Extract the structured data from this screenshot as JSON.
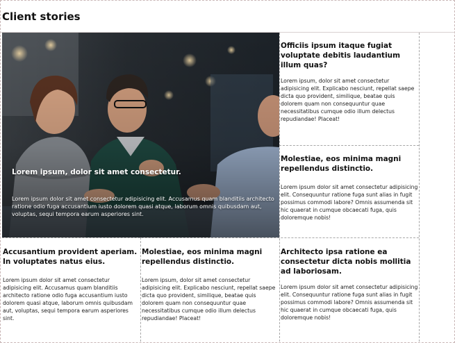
{
  "page": {
    "title": "Client stories"
  },
  "feature": {
    "title": "Lorem ipsum, dolor sit amet consectetur.",
    "body": "Lorem ipsum dolor sit amet consectetur adipisicing elit. Accusamus quam blanditiis architecto ratione odio fuga accusantium iusto dolorem quasi atque, laborum omnis quibusdam aut, voluptas, sequi tempora earum asperiores sint."
  },
  "cards": [
    {
      "title": "Officiis ipsum itaque fugiat voluptate debitis laudantium illum quas?",
      "body": "Lorem ipsum, dolor sit amet consectetur adipisicing elit. Explicabo nesciunt, repellat saepe dicta quo provident, similique, beatae quis dolorem quam non consequuntur quae necessitatibus cumque odio illum delectus repudiandae! Placeat!"
    },
    {
      "title": "Molestiae, eos minima magni repellendus distinctio.",
      "body": "Lorem ipsum dolor sit amet consectetur adipisicing elit. Consequuntur ratione fuga sunt alias in fugit possimus commodi labore? Omnis assumenda sit hic quaerat in cumque obcaecati fuga, quis doloremque nobis!"
    },
    {
      "title": "Accusantium provident aperiam. In voluptates natus eius.",
      "body": "Lorem ipsum dolor sit amet consectetur adipisicing elit. Accusamus quam blanditiis architecto ratione odio fuga accusantium iusto dolorem quasi atque, laborum omnis quibusdam aut, voluptas, sequi tempora earum asperiores sint."
    },
    {
      "title": "Molestiae, eos minima magni repellendus distinctio.",
      "body": "Lorem ipsum, dolor sit amet consectetur adipisicing elit. Explicabo nesciunt, repellat saepe dicta quo provident, similique, beatae quis dolorem quam non consequuntur quae necessitatibus cumque odio illum delectus repudiandae! Placeat!"
    },
    {
      "title": "Architecto ipsa ratione ea consectetur dicta nobis mollitia ad laboriosam.",
      "body": "Lorem ipsum dolor sit amet consectetur adipisicing elit. Consequuntur ratione fuga sunt alias in fugit possimus commodi labore? Omnis assumenda sit hic quaerat in cumque obcaecati fuga, quis doloremque nobis!"
    }
  ]
}
